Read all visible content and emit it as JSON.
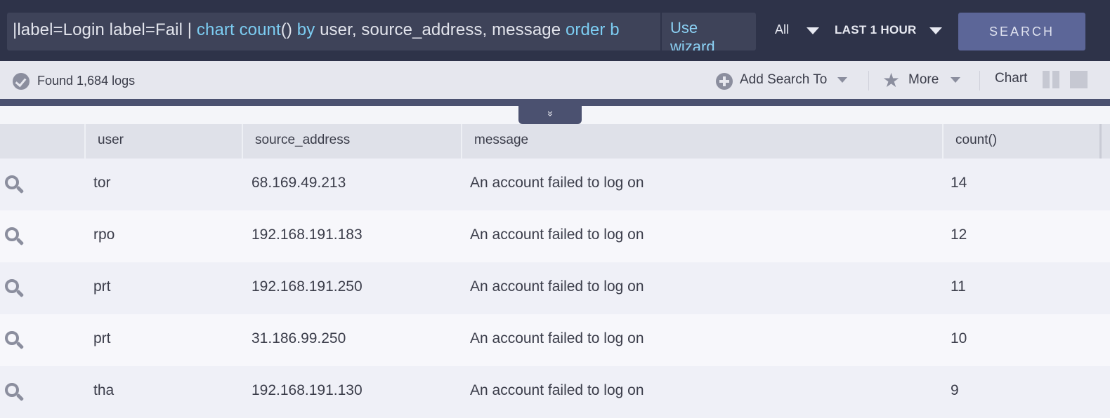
{
  "search": {
    "query_prefix": "|label=Login label=Fail | ",
    "kw_chart": "chart",
    "kw_count": "count",
    "paren": "()",
    "kw_by": "by",
    "fields": " user, source_address, message ",
    "kw_order": "order b",
    "wizard_label": "Use wizard",
    "scope_label": "All",
    "time_range": "LAST 1 HOUR",
    "search_button": "SEARCH"
  },
  "toolbar": {
    "found_text": "Found 1,684 logs",
    "add_search_to": "Add Search To",
    "more": "More",
    "chart": "Chart",
    "collapse_glyph": "»"
  },
  "table": {
    "columns": [
      "user",
      "source_address",
      "message",
      "count()"
    ],
    "rows": [
      {
        "user": "tor",
        "source_address": "68.169.49.213",
        "message": "An account failed to log on",
        "count": "14"
      },
      {
        "user": "rpo",
        "source_address": "192.168.191.183",
        "message": "An account failed to log on",
        "count": "12"
      },
      {
        "user": "prt",
        "source_address": "192.168.191.250",
        "message": "An account failed to log on",
        "count": "11"
      },
      {
        "user": "prt",
        "source_address": "31.186.99.250",
        "message": "An account failed to log on",
        "count": "10"
      },
      {
        "user": "tha",
        "source_address": "192.168.191.130",
        "message": "An account failed to log on",
        "count": "9"
      }
    ]
  },
  "icons": {
    "status": "check-circle-icon",
    "add": "plus-circle-icon",
    "more": "star-icon",
    "row_action": "magnifier-icon",
    "layout_split": "split-view-icon",
    "layout_full": "full-view-icon"
  },
  "colors": {
    "topbar_bg": "#2e3349",
    "keyword": "#7ccdf2",
    "search_button": "#5c6698"
  }
}
